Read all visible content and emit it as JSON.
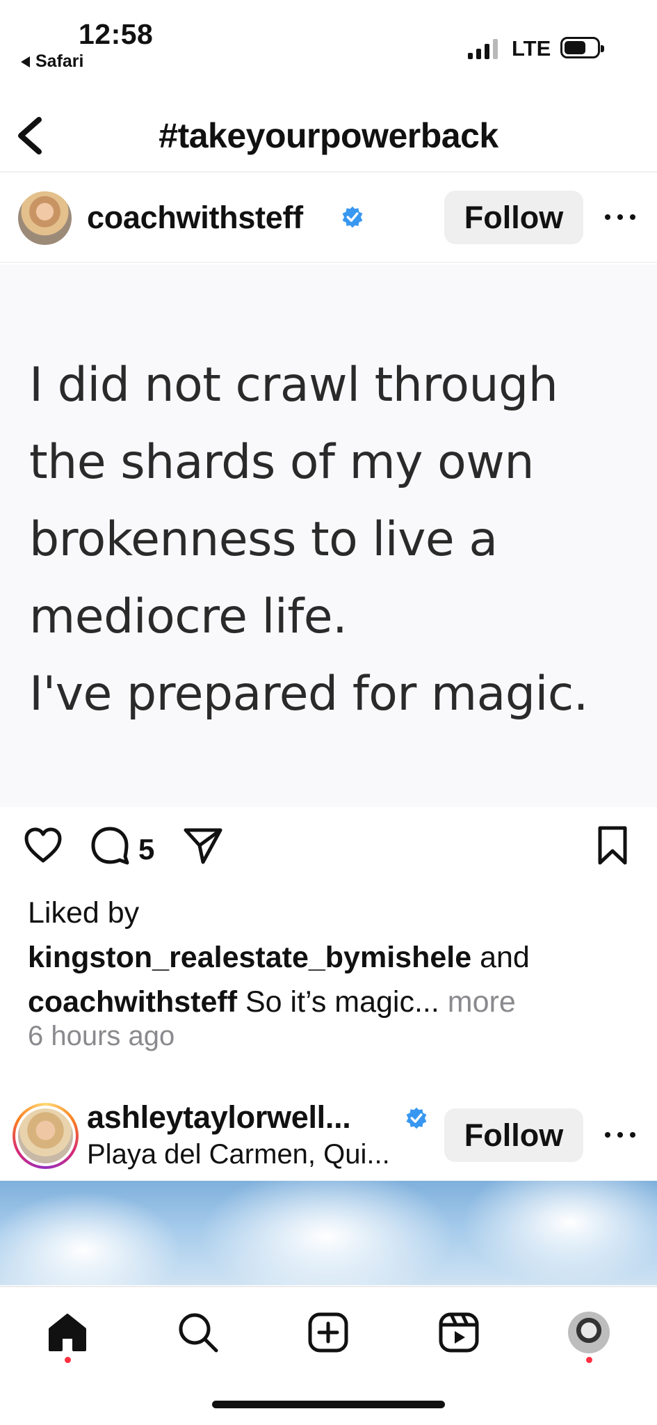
{
  "status_bar": {
    "time": "12:58",
    "back_app": "Safari",
    "network": "LTE",
    "signal_bars_active": 3,
    "signal_bars_total": 4,
    "battery_level": 0.6
  },
  "header": {
    "title": "#takeyourpowerback",
    "back_icon": "chevron-left-icon"
  },
  "post1": {
    "username": "coachwithsteff",
    "verified": true,
    "follow_label": "Follow",
    "image_text": "I did not crawl through\nthe shards of my own\nbrokenness to live a\nmediocre life.\nI've prepared for magic.",
    "comment_count": "5",
    "liked_by_prefix": "Liked by",
    "liked_by_user": "kingston_realestate_bymishele",
    "liked_by_suffix": "and",
    "caption_user": "coachwithsteff",
    "caption_text": "So it’s magic...",
    "more_label": "more",
    "timestamp": "6 hours ago"
  },
  "post2": {
    "username": "ashleytaylorwell...",
    "verified": true,
    "location": "Playa del Carmen, Qui...",
    "follow_label": "Follow"
  },
  "tab_bar": {
    "items": [
      "home-icon",
      "search-icon",
      "create-icon",
      "reels-icon",
      "profile-avatar"
    ]
  },
  "colors": {
    "verified_blue": "#3897f0",
    "notification_red": "#ff3040",
    "secondary_text": "#8a8a8e",
    "button_bg": "#efefef"
  }
}
